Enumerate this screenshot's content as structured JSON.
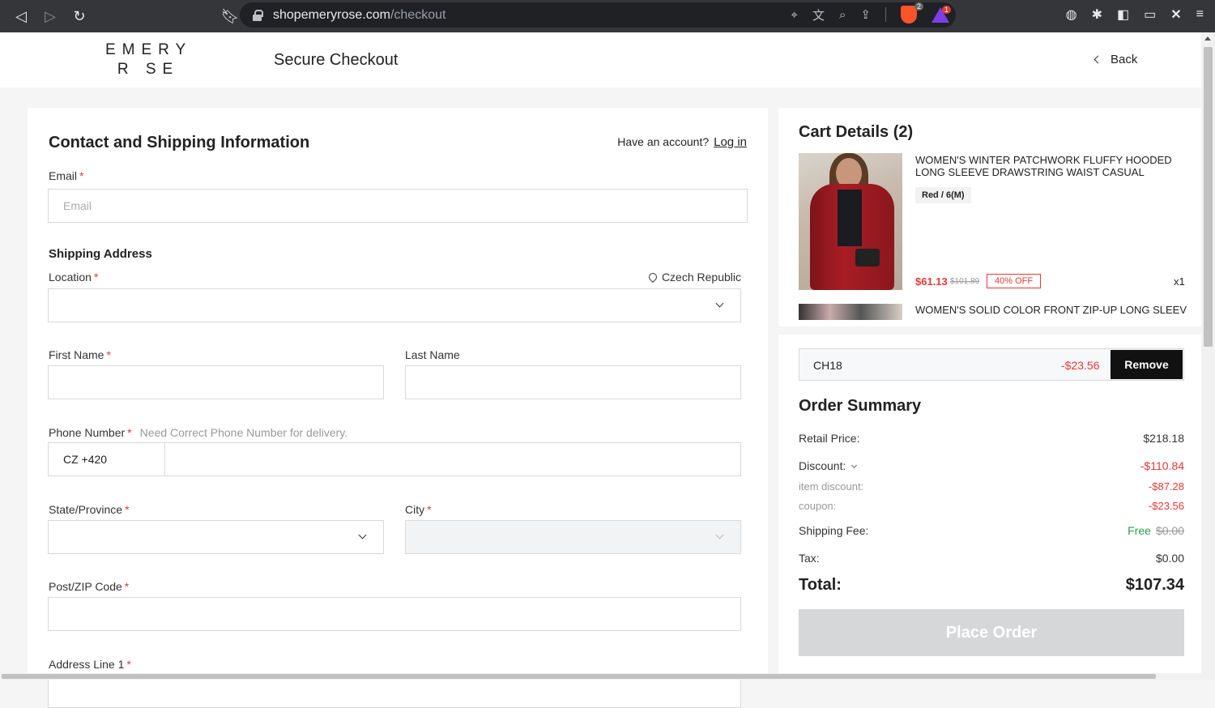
{
  "browser": {
    "url_domain": "shopemeryrose.com",
    "url_path": "/checkout",
    "shield_count": "2",
    "alert_count": "1"
  },
  "header": {
    "logo_line1": "EMERY",
    "logo_line2": "R SE",
    "title": "Secure Checkout",
    "back_label": "Back"
  },
  "form": {
    "title": "Contact and Shipping Information",
    "have_account": "Have an account?",
    "login_label": "Log in",
    "email_label": "Email",
    "email_placeholder": "Email",
    "shipping_title": "Shipping Address",
    "location_label": "Location",
    "country": "Czech Republic",
    "first_name_label": "First Name",
    "last_name_label": "Last Name",
    "phone_label": "Phone Number",
    "phone_hint": "Need Correct Phone Number for delivery.",
    "phone_prefix": "CZ +420",
    "state_label": "State/Province",
    "city_label": "City",
    "zip_label": "Post/ZIP Code",
    "address1_label": "Address Line 1",
    "required_mark": "*"
  },
  "cart": {
    "title": "Cart Details (2)",
    "items": [
      {
        "name": "WOMEN'S WINTER PATCHWORK FLUFFY HOODED LONG SLEEVE DRAWSTRING WAIST CASUAL LOOSE...",
        "variant": "Red / 6(M)",
        "price": "$61.13",
        "original_price": "$101.89",
        "discount_badge": "40% OFF",
        "qty": "x1"
      },
      {
        "name": "WOMEN'S SOLID COLOR FRONT ZIP-UP LONG SLEEVE"
      }
    ]
  },
  "summary": {
    "coupon_code": "CH18",
    "coupon_amount": "-$23.56",
    "remove_label": "Remove",
    "title": "Order Summary",
    "retail_label": "Retail Price:",
    "retail_value": "$218.18",
    "discount_label": "Discount:",
    "discount_value": "-$110.84",
    "item_discount_label": "item discount:",
    "item_discount_value": "-$87.28",
    "coupon_label": "coupon:",
    "coupon_value": "-$23.56",
    "shipping_label": "Shipping Fee:",
    "shipping_free": "Free",
    "shipping_original": "$0.00",
    "tax_label": "Tax:",
    "tax_value": "$0.00",
    "total_label": "Total:",
    "total_value": "$107.34",
    "place_order_label": "Place Order"
  },
  "colors": {
    "accent_red": "#e53935",
    "free_green": "#2e9d4a",
    "button_dark": "#111111",
    "disabled_button": "#d6d7d9"
  }
}
